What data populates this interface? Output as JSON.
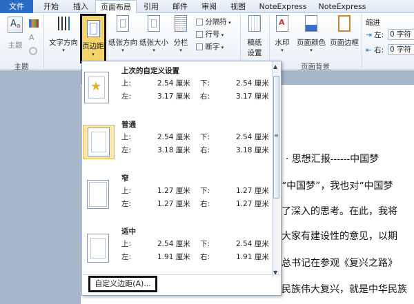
{
  "tabs": [
    "文件",
    "开始",
    "插入",
    "页面布局",
    "引用",
    "邮件",
    "审阅",
    "视图",
    "NoteExpress",
    "NoteExpress"
  ],
  "ribbon": {
    "theme_btn": "主题",
    "theme_group": "主题",
    "text_direction": "文字方向",
    "margins": "页边距",
    "orientation": "纸张方向",
    "size": "纸张大小",
    "columns": "分栏",
    "breaks": "分隔符",
    "line_numbers": "行号",
    "hyphenation": "断字",
    "paper_setup": "稿纸\n设置",
    "paper_setup_l1": "稿纸",
    "paper_setup_l2": "设置",
    "watermark": "水印",
    "page_color": "页面颜色",
    "page_borders": "页面边框",
    "page_bg_group": "页面背景",
    "indent_title": "缩进",
    "indent_left_label": "左:",
    "indent_left_value": "0 字符",
    "indent_right_label": "右:",
    "indent_right_value": "0 字符"
  },
  "margins_menu": {
    "options": [
      {
        "name": "上次的自定义设置",
        "top_label": "上:",
        "top": "2.54 厘米",
        "bottom_label": "下:",
        "bottom": "2.54 厘米",
        "left_label": "左:",
        "left": "3.17 厘米",
        "right_label": "右:",
        "right": "3.17 厘米"
      },
      {
        "name": "普通",
        "top_label": "上:",
        "top": "2.54 厘米",
        "bottom_label": "下:",
        "bottom": "2.54 厘米",
        "left_label": "左:",
        "left": "3.18 厘米",
        "right_label": "右:",
        "right": "3.18 厘米"
      },
      {
        "name": "窄",
        "top_label": "上:",
        "top": "1.27 厘米",
        "bottom_label": "下:",
        "bottom": "1.27 厘米",
        "left_label": "左:",
        "left": "1.27 厘米",
        "right_label": "右:",
        "right": "1.27 厘米"
      },
      {
        "name": "适中",
        "top_label": "上:",
        "top": "2.54 厘米",
        "bottom_label": "下:",
        "bottom": "2.54 厘米",
        "left_label": "左:",
        "left": "1.91 厘米",
        "right_label": "右:",
        "right": "1.91 厘米"
      }
    ],
    "custom": "自定义边距(A)..."
  },
  "document": {
    "lines": [
      "· · 思想汇报------中国梦",
      "“中国梦”，我也对“中国梦",
      "了深入的思考。在此，我将",
      "大家有建设性的意见，以期",
      "总书记在参观《复兴之路》",
      "民族伟大复兴，就是中华民族"
    ]
  }
}
